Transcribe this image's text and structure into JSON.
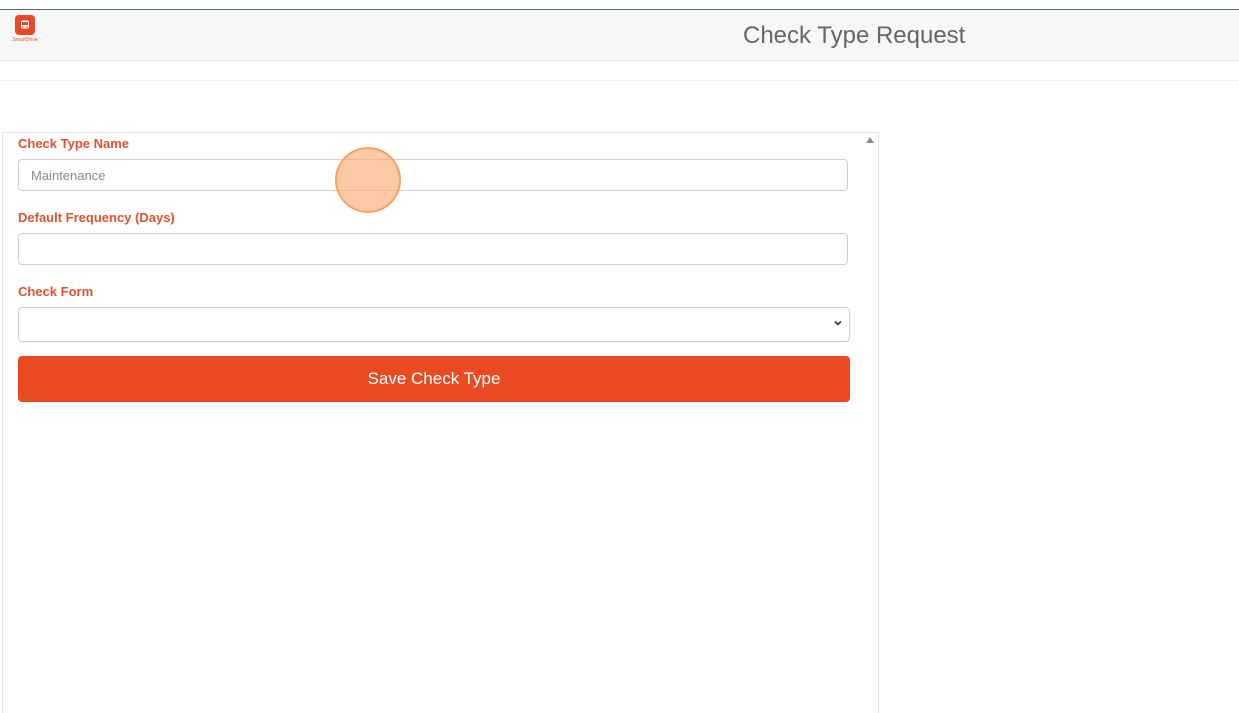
{
  "header": {
    "title": "Check Type Request",
    "logo_icon": "bus-icon",
    "logo_text": "SmartDrive"
  },
  "form": {
    "check_type_name": {
      "label": "Check Type Name",
      "placeholder": "Maintenance",
      "value": ""
    },
    "default_frequency": {
      "label": "Default Frequency (Days)",
      "placeholder": "",
      "value": ""
    },
    "check_form": {
      "label": "Check Form",
      "selected": ""
    },
    "save_label": "Save Check Type"
  },
  "colors": {
    "accent": "#e94a22",
    "label": "#e0522f",
    "title": "#666666"
  }
}
